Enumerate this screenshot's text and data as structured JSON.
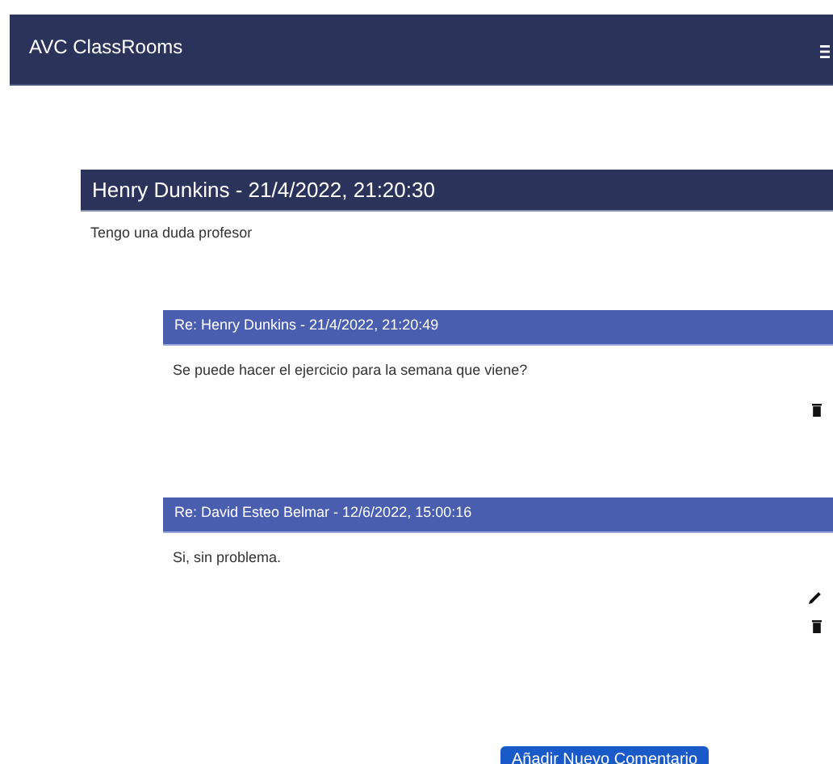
{
  "navbar": {
    "brand": "AVC ClassRooms"
  },
  "post": {
    "header": "Henry Dunkins - 21/4/2022, 21:20:30",
    "body": "Tengo una duda profesor"
  },
  "replies": [
    {
      "header": "Re: Henry Dunkins - 21/4/2022, 21:20:49",
      "body": "Se puede hacer el ejercicio para la semana que viene?",
      "can_edit": false,
      "can_delete": true
    },
    {
      "header": "Re: David Esteo Belmar - 12/6/2022, 15:00:16",
      "body": "Si, sin problema.",
      "can_edit": true,
      "can_delete": true
    }
  ],
  "add_button": "Añadir Nuevo Comentario"
}
